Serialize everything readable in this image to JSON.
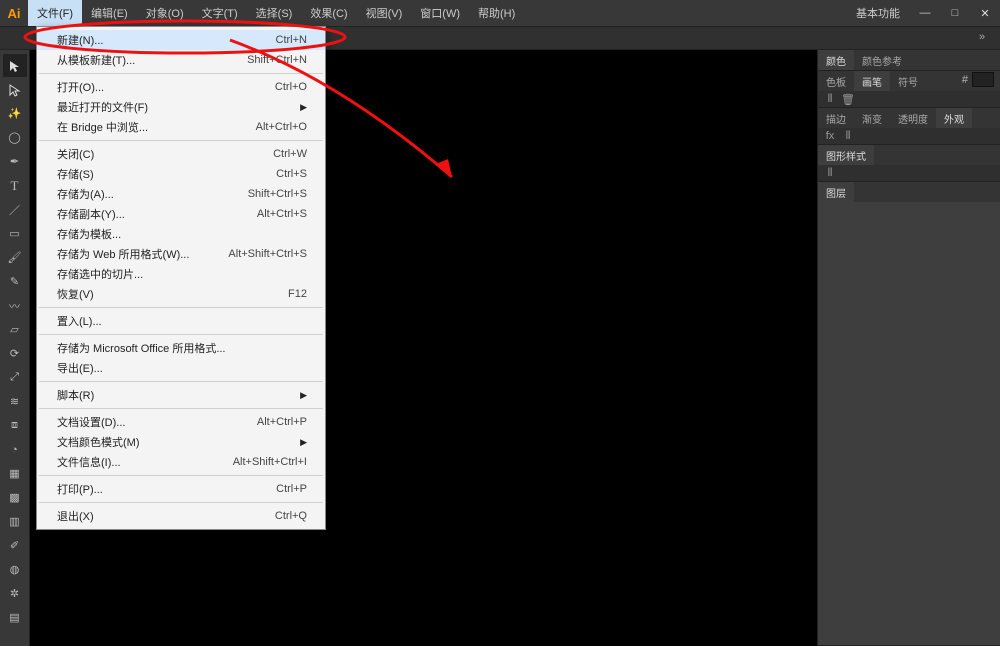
{
  "app": "Ai",
  "menu": {
    "items": [
      "文件(F)",
      "编辑(E)",
      "对象(O)",
      "文字(T)",
      "选择(S)",
      "效果(C)",
      "视图(V)",
      "窗口(W)",
      "帮助(H)"
    ],
    "open_index": 0
  },
  "workspace_label": "基本功能",
  "win": {
    "min": "—",
    "max": "□",
    "close": "✕"
  },
  "file_menu": [
    {
      "label": "新建(N)...",
      "shortcut": "Ctrl+N",
      "hl": true
    },
    {
      "label": "从模板新建(T)...",
      "shortcut": "Shift+Ctrl+N"
    },
    {
      "sep": true
    },
    {
      "label": "打开(O)...",
      "shortcut": "Ctrl+O"
    },
    {
      "label": "最近打开的文件(F)",
      "sub": true
    },
    {
      "label": "在 Bridge 中浏览...",
      "shortcut": "Alt+Ctrl+O"
    },
    {
      "sep": true
    },
    {
      "label": "关闭(C)",
      "shortcut": "Ctrl+W"
    },
    {
      "label": "存储(S)",
      "shortcut": "Ctrl+S"
    },
    {
      "label": "存储为(A)...",
      "shortcut": "Shift+Ctrl+S"
    },
    {
      "label": "存储副本(Y)...",
      "shortcut": "Alt+Ctrl+S"
    },
    {
      "label": "存储为模板..."
    },
    {
      "label": "存储为 Web 所用格式(W)...",
      "shortcut": "Alt+Shift+Ctrl+S"
    },
    {
      "label": "存储选中的切片..."
    },
    {
      "label": "恢复(V)",
      "shortcut": "F12"
    },
    {
      "sep": true
    },
    {
      "label": "置入(L)..."
    },
    {
      "sep": true
    },
    {
      "label": "存储为 Microsoft Office 所用格式..."
    },
    {
      "label": "导出(E)..."
    },
    {
      "sep": true
    },
    {
      "label": "脚本(R)",
      "sub": true
    },
    {
      "sep": true
    },
    {
      "label": "文档设置(D)...",
      "shortcut": "Alt+Ctrl+P"
    },
    {
      "label": "文档颜色模式(M)",
      "sub": true
    },
    {
      "label": "文件信息(I)...",
      "shortcut": "Alt+Shift+Ctrl+I"
    },
    {
      "sep": true
    },
    {
      "label": "打印(P)...",
      "shortcut": "Ctrl+P"
    },
    {
      "sep": true
    },
    {
      "label": "退出(X)",
      "shortcut": "Ctrl+Q"
    }
  ],
  "tools": [
    "selection",
    "direct-selection",
    "magic-wand",
    "lasso",
    "pen",
    "type",
    "line",
    "rectangle",
    "paint-brush",
    "pencil",
    "blob-brush",
    "eraser",
    "rotate",
    "scale",
    "width",
    "free-transform",
    "shape-builder",
    "perspective",
    "mesh",
    "gradient",
    "eyedropper",
    "blend",
    "symbol-sprayer",
    "graph",
    "artboard",
    "slice",
    "hand",
    "zoom"
  ],
  "panels": {
    "g1": {
      "tabs": [
        "颜色",
        "颜色参考"
      ],
      "active": 0,
      "body_h": 118,
      "hash": "#"
    },
    "g2": {
      "tabs": [
        "色板",
        "画笔",
        "符号"
      ],
      "active": 1,
      "body_h": 92
    },
    "g3": {
      "tabs": [
        "描边",
        "渐变",
        "透明度",
        "外观"
      ],
      "active": 3,
      "body_h": 118
    },
    "g4": {
      "tabs": [
        "图形样式"
      ],
      "active": 0,
      "body_h": 82
    },
    "g5": {
      "tabs": [
        "图层"
      ],
      "active": 0,
      "body_h": 6
    }
  },
  "panel_foot_icon": "⦀"
}
